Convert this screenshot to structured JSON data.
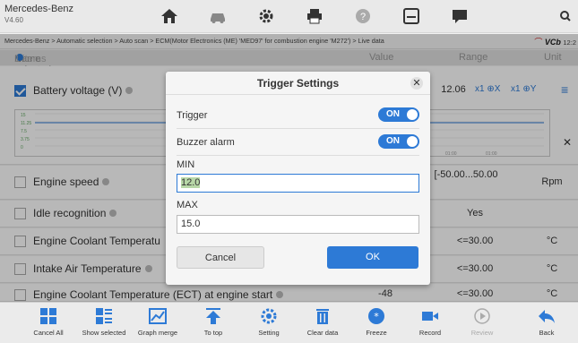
{
  "app": {
    "title": "Mercedes-Benz",
    "version": "V4.60"
  },
  "breadcrumb": "Mercedes-Benz > Automatic selection > Auto scan > ECM(Motor Electronics (ME) 'MED97' for combustion engine 'M272') > Live data",
  "vci": {
    "label": "VCb",
    "time": "12:2"
  },
  "header": {
    "name": "Name",
    "selected": "1 items selected",
    "value": "Value",
    "range": "Range",
    "unit": "Unit"
  },
  "rows": [
    {
      "name": "Battery voltage  (V)",
      "value": "12.06",
      "range": "",
      "unit": "",
      "checked": true
    },
    {
      "name": "Engine speed",
      "value": "",
      "range": "[-50.00...50.00",
      "unit": "Rpm",
      "checked": false
    },
    {
      "name": "Idle recognition",
      "value": "",
      "range": "Yes",
      "unit": "",
      "checked": false
    },
    {
      "name": "Engine Coolant Temperatu",
      "value": "",
      "range": "<=30.00",
      "unit": "°C",
      "checked": false
    },
    {
      "name": "Intake Air Temperature",
      "value": "",
      "range": "<=30.00",
      "unit": "°C",
      "checked": false
    },
    {
      "name": "Engine Coolant Temperature (ECT) at engine start",
      "value": "-48",
      "range": "<=30.00",
      "unit": "°C",
      "checked": false
    }
  ],
  "graph": {
    "y_ticks": [
      "15",
      "11.25",
      "7.5",
      "3.75",
      "0"
    ],
    "x_ticks": [
      "01:00",
      "01:00"
    ]
  },
  "zoom": {
    "x": "x1",
    "y": "x1"
  },
  "dialog": {
    "title": "Trigger Settings",
    "trigger_label": "Trigger",
    "trigger_state": "ON",
    "buzzer_label": "Buzzer alarm",
    "buzzer_state": "ON",
    "min_label": "MIN",
    "min_value": "12.0",
    "max_label": "MAX",
    "max_value": "15.0",
    "cancel_label": "Cancel",
    "ok_label": "OK"
  },
  "bottom": [
    "Cancel All",
    "Show selected",
    "Graph merge",
    "To top",
    "Setting",
    "Clear data",
    "Freeze",
    "Record",
    "Review",
    "Back"
  ],
  "colors": {
    "accent": "#2d7ad6",
    "toolbar_bg": "#ebebeb"
  }
}
